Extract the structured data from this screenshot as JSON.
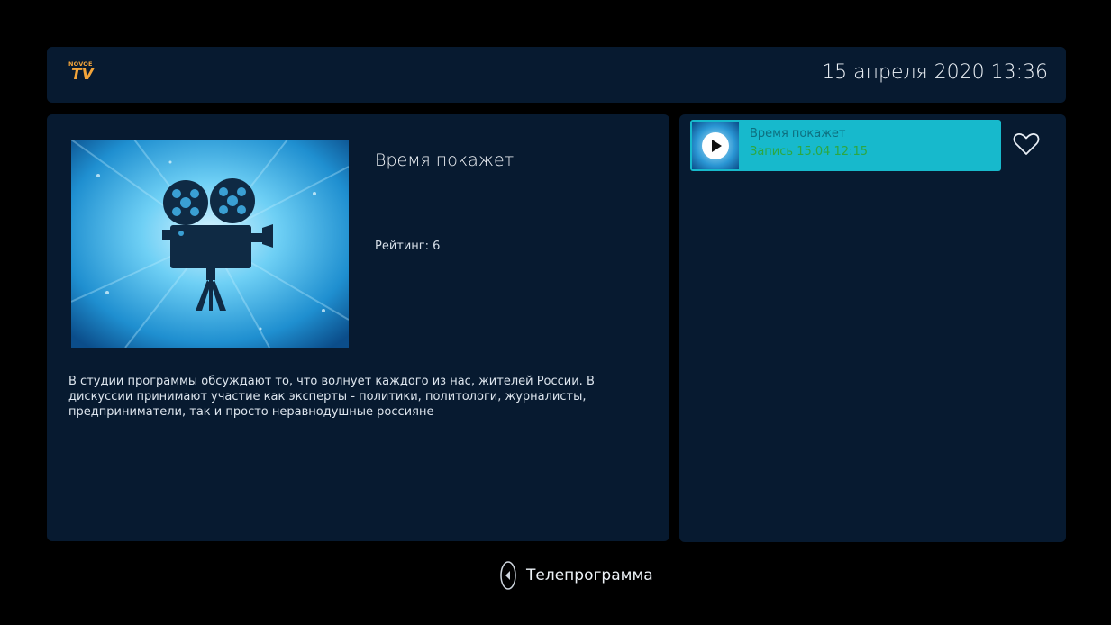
{
  "header": {
    "logo": {
      "top_text": "NOVOE",
      "main_text": "TV"
    },
    "datetime": "15 апреля 2020 13:36"
  },
  "program": {
    "title": "Время покажет",
    "rating": "Рейтинг: 6",
    "description": "В студии программы обсуждают то, что волнует каждого из нас, жителей России. В дискуссии принимают участие как эксперты - политики, политологи, журналисты, предприниматели, так и просто неравнодушные россияне"
  },
  "recordings": [
    {
      "title": "Время покажет",
      "subtitle": "Запись 15.04 12:15"
    }
  ],
  "footer": {
    "label": "Телепрограмма"
  },
  "colors": {
    "panel": "#071a30",
    "accent": "#17b9cc",
    "logo": "#f2a43a",
    "record_green": "#2ca842"
  },
  "icons": {
    "poster": "film-projector-icon",
    "play": "play-icon",
    "favorite": "heart-icon",
    "back": "remote-back-icon"
  }
}
